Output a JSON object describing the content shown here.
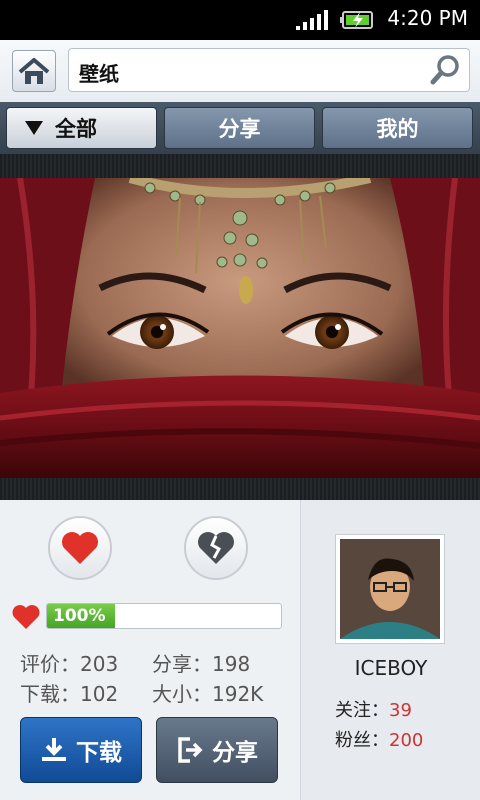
{
  "status_bar": {
    "time": "4:20 PM"
  },
  "search": {
    "value": "壁纸"
  },
  "tabs": [
    {
      "label": "全部",
      "active": true
    },
    {
      "label": "分享",
      "active": false
    },
    {
      "label": "我的",
      "active": false
    }
  ],
  "stats": {
    "progress_text": "100%",
    "progress_value": 1.0,
    "rating": "评价：203",
    "share": "分享：198",
    "download": "下载：102",
    "size": "大小：192K"
  },
  "actions": {
    "download_label": "下载",
    "share_label": "分享"
  },
  "user": {
    "name": "ICEBOY",
    "follow_label": "关注：",
    "follow_count": "39",
    "fans_label": "粉丝：",
    "fans_count": "200"
  },
  "colors": {
    "accent_blue": "#1a5aa8",
    "progress_green": "#4caf2a",
    "heart_red": "#e0322b",
    "count_red": "#cc3333"
  },
  "icons": [
    "signal-icon",
    "battery-icon",
    "home-icon",
    "search-icon",
    "like-heart-icon",
    "broken-heart-icon",
    "small-heart-icon",
    "download-icon",
    "share-exit-icon"
  ]
}
